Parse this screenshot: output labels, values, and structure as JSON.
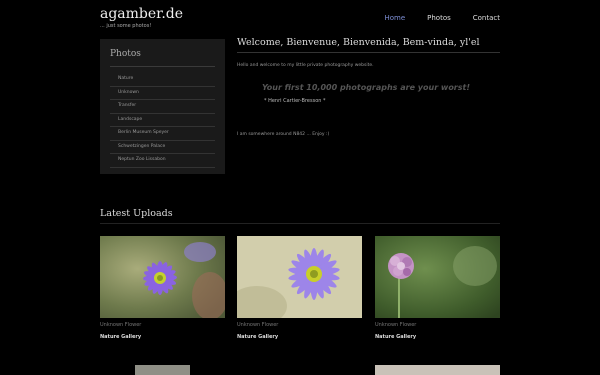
{
  "site": {
    "title": "agamber.de",
    "tagline": "... just some photos!"
  },
  "nav": [
    {
      "label": "Home",
      "active": true
    },
    {
      "label": "Photos",
      "active": false
    },
    {
      "label": "Contact",
      "active": false
    }
  ],
  "sidebar": {
    "title": "Photos",
    "items": [
      "Nature",
      "Unknown",
      "Transfer",
      "Landscape",
      "Berlin Museum Speyer",
      "Schwetzingen Palace",
      "Neptun Zoo Lissabon"
    ]
  },
  "welcome": {
    "heading": "Welcome, Bienvenue, Bienvenida, Bem-vinda, yl'el",
    "intro": "Hello and welcome to my little private photography website.",
    "quote": "Your first 10,000 photographs are your worst!",
    "quote_author": "* Henri Cartier-Bresson *",
    "location": "I am somewhere around N842 ... Enjoy :)"
  },
  "latest": {
    "title": "Latest Uploads",
    "items": [
      {
        "caption": "Unknown Flower",
        "gallery": "Nature Gallery",
        "icon": "blue-daisy-photo"
      },
      {
        "caption": "Unknown Flower",
        "gallery": "Nature Gallery",
        "icon": "blue-daisy-photo"
      },
      {
        "caption": "Unknown Flower",
        "gallery": "Nature Gallery",
        "icon": "pink-scabiosa-photo"
      }
    ]
  },
  "colors": {
    "nav_active": "#7e8fd6",
    "background": "#000000",
    "sidebar_bg": "#1a1a1a"
  }
}
